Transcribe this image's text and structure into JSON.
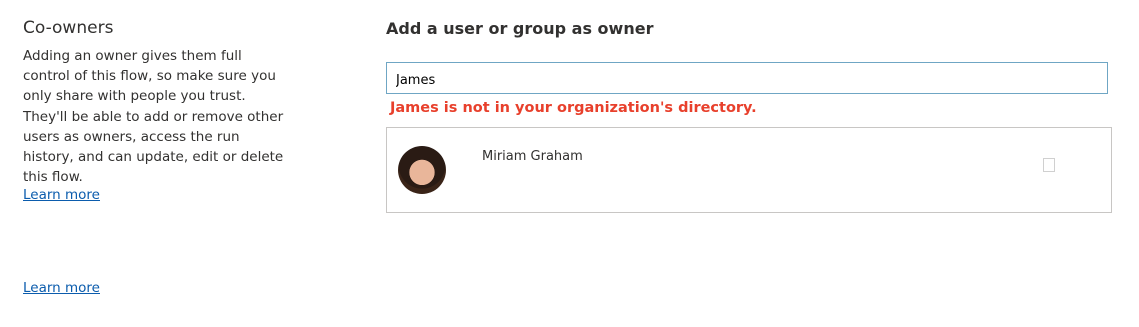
{
  "coowners": {
    "title": "Co-owners",
    "description": "Adding an owner gives them full control of this flow, so make sure you only share with people you trust. They'll be able to add or remove other users as owners, access the run history, and can update, edit or delete this flow.",
    "learn_more": "Learn more",
    "learn_more_bottom": "Learn more"
  },
  "add_owner": {
    "title": "Add a user or group as owner",
    "search_value": "James",
    "error": "James is not in your organization's directory.",
    "results": [
      {
        "name": "Miriam Graham",
        "avatar_icon": "user-photo",
        "checked": false
      }
    ]
  },
  "colors": {
    "link": "#0b5cad",
    "error": "#e8402c",
    "input_border": "#6fa6c4"
  }
}
